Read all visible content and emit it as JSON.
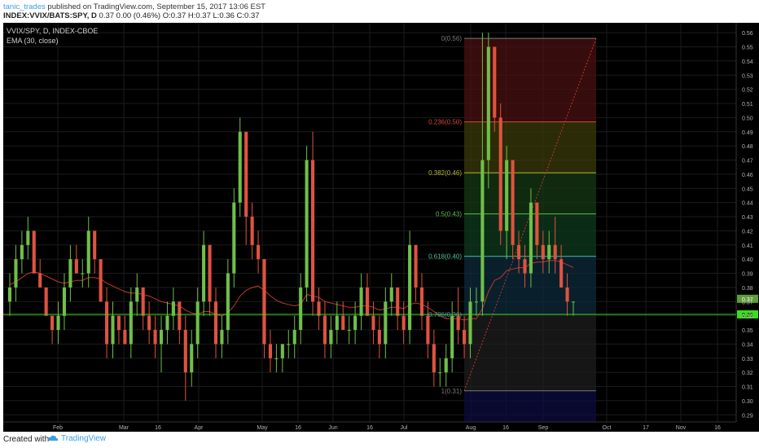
{
  "header": {
    "publisher": "tanic_trades",
    "published_text": " published on TradingView.com, September 15, 2017 13:06 EST",
    "symbol_line": "INDEX:VVIX/BATS:SPY, D",
    "values_line": "0.37 0.00 (0.46%) O:0.37 H:0.37 L:0.36 C:0.37"
  },
  "legend": {
    "title": "VVIX/SPY, D, INDEX-CBOE",
    "indicator": "EMA (30, close)"
  },
  "footer": {
    "created_with": "Created with",
    "brand": "TradingView"
  },
  "colors": {
    "background": "#000000",
    "up_candle": "#6fbf4a",
    "down_candle": "#e0533f",
    "ema_line": "#c0392b",
    "horizontal_line": "#3ddc1f",
    "grid": "#1c1c1c",
    "axis_text": "#b4b4b4",
    "price_badge_current": "#5c9e3a",
    "price_badge_line": "#3ddc1f"
  },
  "chart_data": {
    "type": "candlestick",
    "y_range": [
      0.285,
      0.567
    ],
    "y_ticks": [
      "0.56",
      "0.55",
      "0.54",
      "0.53",
      "0.52",
      "0.51",
      "0.50",
      "0.49",
      "0.48",
      "0.47",
      "0.46",
      "0.45",
      "0.44",
      "0.43",
      "0.42",
      "0.41",
      "0.40",
      "0.39",
      "0.38",
      "0.37",
      "0.36",
      "0.35",
      "0.34",
      "0.33",
      "0.32",
      "0.31",
      "0.30",
      "0.29"
    ],
    "x_ticks": [
      "Feb",
      "Mar",
      "16",
      "Apr",
      "May",
      "16",
      "Jun",
      "16",
      "Jul",
      "Aug",
      "16",
      "Sep",
      "Oct",
      "17",
      "Nov",
      "16"
    ],
    "current_price_label": "0.37",
    "horizontal_line_label": "0.36",
    "horizontal_line_value": 0.361,
    "fib_levels": [
      {
        "label": "0(0.56)",
        "value": 0.556,
        "color": "#7a7a7a",
        "zone": "#4a1010"
      },
      {
        "label": "0.236(0.50)",
        "value": 0.497,
        "color": "#d24a3a",
        "zone": "#3a3a0a"
      },
      {
        "label": "0.382(0.46)",
        "value": 0.461,
        "color": "#b8b83a",
        "zone": "#143814"
      },
      {
        "label": "0.5(0.43)",
        "value": 0.432,
        "color": "#5bbf4a",
        "zone": "#0e3a1e"
      },
      {
        "label": "0.618(0.40)",
        "value": 0.402,
        "color": "#4ac0a0",
        "zone": "#0c2a3a"
      },
      {
        "label": "0.786(0.36)",
        "value": 0.361,
        "color": "#4a8ac0",
        "zone": "#1e1e1e"
      },
      {
        "label": "1(0.31)",
        "value": 0.307,
        "color": "#7a7a7a",
        "zone": "#0c0c40"
      }
    ],
    "candles": [
      [
        0.37,
        0.39,
        0.36,
        0.38
      ],
      [
        0.38,
        0.41,
        0.37,
        0.4
      ],
      [
        0.4,
        0.42,
        0.39,
        0.41
      ],
      [
        0.41,
        0.43,
        0.4,
        0.42
      ],
      [
        0.42,
        0.42,
        0.39,
        0.39
      ],
      [
        0.39,
        0.4,
        0.38,
        0.38
      ],
      [
        0.38,
        0.38,
        0.36,
        0.36
      ],
      [
        0.36,
        0.36,
        0.34,
        0.35
      ],
      [
        0.35,
        0.37,
        0.34,
        0.36
      ],
      [
        0.36,
        0.39,
        0.35,
        0.38
      ],
      [
        0.38,
        0.41,
        0.37,
        0.4
      ],
      [
        0.4,
        0.41,
        0.39,
        0.39
      ],
      [
        0.39,
        0.4,
        0.38,
        0.39
      ],
      [
        0.39,
        0.43,
        0.38,
        0.42
      ],
      [
        0.42,
        0.42,
        0.39,
        0.4
      ],
      [
        0.4,
        0.4,
        0.37,
        0.37
      ],
      [
        0.37,
        0.38,
        0.33,
        0.34
      ],
      [
        0.34,
        0.37,
        0.33,
        0.36
      ],
      [
        0.36,
        0.36,
        0.34,
        0.35
      ],
      [
        0.35,
        0.36,
        0.34,
        0.34
      ],
      [
        0.34,
        0.38,
        0.33,
        0.37
      ],
      [
        0.37,
        0.39,
        0.36,
        0.38
      ],
      [
        0.38,
        0.38,
        0.35,
        0.36
      ],
      [
        0.36,
        0.37,
        0.34,
        0.35
      ],
      [
        0.35,
        0.36,
        0.33,
        0.34
      ],
      [
        0.34,
        0.36,
        0.32,
        0.35
      ],
      [
        0.35,
        0.37,
        0.34,
        0.36
      ],
      [
        0.36,
        0.38,
        0.35,
        0.37
      ],
      [
        0.37,
        0.37,
        0.34,
        0.35
      ],
      [
        0.35,
        0.36,
        0.3,
        0.32
      ],
      [
        0.32,
        0.35,
        0.31,
        0.34
      ],
      [
        0.34,
        0.38,
        0.33,
        0.37
      ],
      [
        0.37,
        0.42,
        0.36,
        0.41
      ],
      [
        0.41,
        0.41,
        0.36,
        0.37
      ],
      [
        0.37,
        0.38,
        0.33,
        0.34
      ],
      [
        0.34,
        0.36,
        0.33,
        0.35
      ],
      [
        0.35,
        0.4,
        0.34,
        0.39
      ],
      [
        0.39,
        0.45,
        0.38,
        0.44
      ],
      [
        0.44,
        0.5,
        0.43,
        0.49
      ],
      [
        0.49,
        0.49,
        0.41,
        0.43
      ],
      [
        0.43,
        0.44,
        0.4,
        0.41
      ],
      [
        0.41,
        0.42,
        0.39,
        0.4
      ],
      [
        0.4,
        0.4,
        0.33,
        0.34
      ],
      [
        0.34,
        0.35,
        0.32,
        0.33
      ],
      [
        0.33,
        0.34,
        0.32,
        0.33
      ],
      [
        0.33,
        0.34,
        0.32,
        0.34
      ],
      [
        0.34,
        0.35,
        0.33,
        0.34
      ],
      [
        0.34,
        0.36,
        0.33,
        0.35
      ],
      [
        0.35,
        0.39,
        0.34,
        0.38
      ],
      [
        0.38,
        0.48,
        0.37,
        0.47
      ],
      [
        0.47,
        0.49,
        0.36,
        0.37
      ],
      [
        0.37,
        0.38,
        0.35,
        0.36
      ],
      [
        0.36,
        0.37,
        0.33,
        0.34
      ],
      [
        0.34,
        0.36,
        0.33,
        0.35
      ],
      [
        0.35,
        0.37,
        0.34,
        0.36
      ],
      [
        0.36,
        0.37,
        0.35,
        0.35
      ],
      [
        0.35,
        0.36,
        0.34,
        0.35
      ],
      [
        0.35,
        0.37,
        0.34,
        0.36
      ],
      [
        0.36,
        0.39,
        0.35,
        0.38
      ],
      [
        0.38,
        0.39,
        0.36,
        0.36
      ],
      [
        0.36,
        0.37,
        0.34,
        0.35
      ],
      [
        0.35,
        0.36,
        0.33,
        0.34
      ],
      [
        0.34,
        0.38,
        0.33,
        0.37
      ],
      [
        0.37,
        0.39,
        0.36,
        0.38
      ],
      [
        0.38,
        0.38,
        0.35,
        0.36
      ],
      [
        0.36,
        0.37,
        0.34,
        0.35
      ],
      [
        0.35,
        0.42,
        0.34,
        0.41
      ],
      [
        0.41,
        0.41,
        0.37,
        0.38
      ],
      [
        0.38,
        0.39,
        0.35,
        0.36
      ],
      [
        0.36,
        0.37,
        0.33,
        0.34
      ],
      [
        0.34,
        0.35,
        0.31,
        0.32
      ],
      [
        0.32,
        0.33,
        0.31,
        0.32
      ],
      [
        0.32,
        0.34,
        0.31,
        0.33
      ],
      [
        0.33,
        0.37,
        0.32,
        0.36
      ],
      [
        0.36,
        0.38,
        0.34,
        0.35
      ],
      [
        0.35,
        0.36,
        0.33,
        0.34
      ],
      [
        0.34,
        0.38,
        0.33,
        0.37
      ],
      [
        0.37,
        0.38,
        0.36,
        0.37
      ],
      [
        0.37,
        0.56,
        0.36,
        0.47
      ],
      [
        0.47,
        0.56,
        0.45,
        0.55
      ],
      [
        0.55,
        0.55,
        0.49,
        0.5
      ],
      [
        0.5,
        0.51,
        0.41,
        0.42
      ],
      [
        0.42,
        0.48,
        0.4,
        0.47
      ],
      [
        0.47,
        0.47,
        0.4,
        0.41
      ],
      [
        0.41,
        0.42,
        0.39,
        0.4
      ],
      [
        0.4,
        0.41,
        0.38,
        0.39
      ],
      [
        0.39,
        0.45,
        0.38,
        0.44
      ],
      [
        0.44,
        0.44,
        0.4,
        0.41
      ],
      [
        0.41,
        0.42,
        0.39,
        0.4
      ],
      [
        0.4,
        0.42,
        0.39,
        0.41
      ],
      [
        0.41,
        0.43,
        0.39,
        0.4
      ],
      [
        0.4,
        0.41,
        0.38,
        0.38
      ],
      [
        0.38,
        0.39,
        0.36,
        0.37
      ],
      [
        0.37,
        0.37,
        0.36,
        0.37
      ]
    ],
    "ema": [
      0.382,
      0.384,
      0.387,
      0.39,
      0.391,
      0.39,
      0.388,
      0.386,
      0.384,
      0.383,
      0.384,
      0.385,
      0.385,
      0.387,
      0.387,
      0.386,
      0.383,
      0.381,
      0.379,
      0.377,
      0.376,
      0.376,
      0.375,
      0.374,
      0.372,
      0.37,
      0.369,
      0.368,
      0.367,
      0.364,
      0.362,
      0.361,
      0.363,
      0.363,
      0.361,
      0.36,
      0.362,
      0.367,
      0.374,
      0.378,
      0.38,
      0.381,
      0.378,
      0.374,
      0.371,
      0.369,
      0.368,
      0.367,
      0.368,
      0.375,
      0.374,
      0.373,
      0.37,
      0.369,
      0.368,
      0.367,
      0.366,
      0.366,
      0.367,
      0.367,
      0.366,
      0.364,
      0.365,
      0.366,
      0.366,
      0.365,
      0.368,
      0.369,
      0.368,
      0.366,
      0.363,
      0.36,
      0.358,
      0.358,
      0.358,
      0.357,
      0.358,
      0.358,
      0.365,
      0.377,
      0.385,
      0.387,
      0.392,
      0.393,
      0.394,
      0.394,
      0.397,
      0.398,
      0.398,
      0.399,
      0.399,
      0.398,
      0.396,
      0.394
    ]
  }
}
